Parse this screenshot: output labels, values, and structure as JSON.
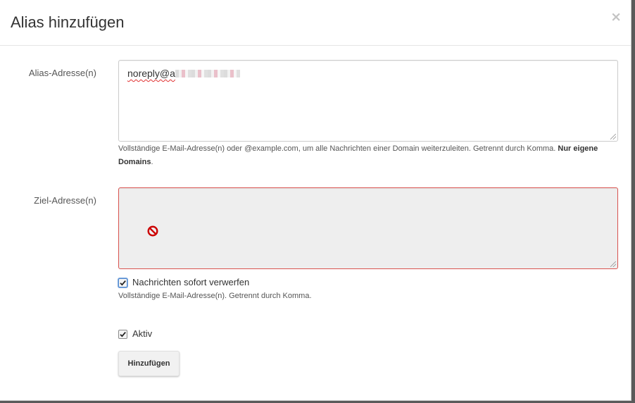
{
  "dialog": {
    "title": "Alias hinzufügen",
    "close_label": "×"
  },
  "alias": {
    "label": "Alias-Adresse(n)",
    "value_prefix": "noreply@a",
    "help_text": "Vollständige E-Mail-Adresse(n) oder @example.com, um alle Nachrichten einer Domain weiterzuleiten. Getrennt durch Komma. ",
    "help_bold": "Nur eigene Domains",
    "help_end": "."
  },
  "target": {
    "label": "Ziel-Adresse(n)",
    "value": "",
    "disabled_icon": "no-entry-icon",
    "error_color": "#d9534f"
  },
  "discard": {
    "label": "Nachrichten sofort verwerfen",
    "checked": true,
    "help_text": "Vollständige E-Mail-Adresse(n). Getrennt durch Komma."
  },
  "active": {
    "label": "Aktiv",
    "checked": true
  },
  "submit": {
    "label": "Hinzufügen"
  }
}
